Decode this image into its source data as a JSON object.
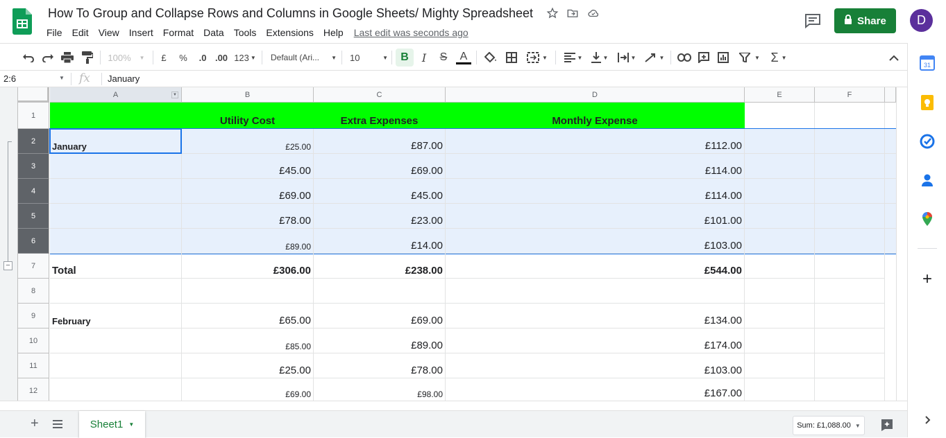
{
  "document": {
    "title": "How To Group and Collapse Rows and Columns in Google Sheets/ Mighty Spreadsheet",
    "last_edit": "Last edit was seconds ago"
  },
  "menu": [
    "File",
    "Edit",
    "View",
    "Insert",
    "Format",
    "Data",
    "Tools",
    "Extensions",
    "Help"
  ],
  "share": {
    "label": "Share",
    "color": "#188038"
  },
  "user": {
    "initial": "D",
    "color": "#5b2f9c"
  },
  "toolbar": {
    "zoom": "100%",
    "currency": "£",
    "percent": "%",
    "decrease_decimals": ".0",
    "increase_decimals": ".00",
    "more_formats": "123",
    "font": "Default (Ari...",
    "font_size": "10",
    "bold": "B"
  },
  "formula_bar": {
    "name_box": "2:6",
    "fx": "fx",
    "value": "January"
  },
  "columns": [
    "A",
    "B",
    "C",
    "D",
    "E",
    "F"
  ],
  "rows": [
    "1",
    "2",
    "3",
    "4",
    "5",
    "6",
    "7",
    "8",
    "9",
    "10",
    "11",
    "12"
  ],
  "header_row": {
    "b": "Utility Cost",
    "c": "Extra Expenses",
    "d": "Monthly Expense",
    "fill": "#00ff00"
  },
  "data_rows": [
    {
      "a": "January",
      "b": "£25.00",
      "c": "£87.00",
      "d": "£112.00"
    },
    {
      "a": "",
      "b": "£45.00",
      "c": "£69.00",
      "d": "£114.00"
    },
    {
      "a": "",
      "b": "£69.00",
      "c": "£45.00",
      "d": "£114.00"
    },
    {
      "a": "",
      "b": "£78.00",
      "c": "£23.00",
      "d": "£101.00"
    },
    {
      "a": "",
      "b": "£89.00",
      "c": "£14.00",
      "d": "£103.00"
    },
    {
      "a": "Total",
      "b": "£306.00",
      "c": "£238.00",
      "d": "£544.00"
    },
    {
      "a": "",
      "b": "",
      "c": "",
      "d": ""
    },
    {
      "a": "February",
      "b": "£65.00",
      "c": "£69.00",
      "d": "£134.00"
    },
    {
      "a": "",
      "b": "£85.00",
      "c": "£89.00",
      "d": "£174.00"
    },
    {
      "a": "",
      "b": "£25.00",
      "c": "£78.00",
      "d": "£103.00"
    },
    {
      "a": "",
      "b": "£69.00",
      "c": "£98.00",
      "d": "£167.00"
    }
  ],
  "group_toggle": "−",
  "sheet_tab": "Sheet1",
  "sum": "Sum: £1,088.00",
  "side_panel": [
    "calendar-icon",
    "keep-icon",
    "tasks-icon",
    "contacts-icon",
    "maps-icon",
    "add-icon"
  ]
}
